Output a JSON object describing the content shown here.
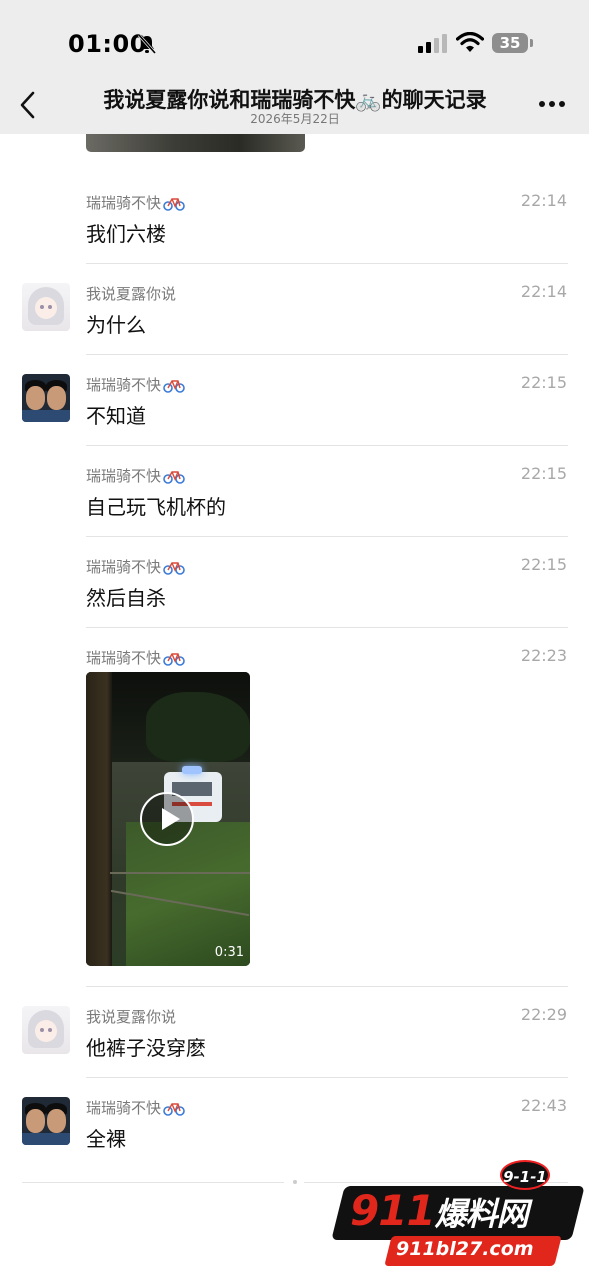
{
  "status_bar": {
    "time": "01:00",
    "battery": "35"
  },
  "header": {
    "title": "我说夏露你说和瑞瑞骑不快🚲的聊天记录",
    "date": "2026年5月22日"
  },
  "messages": [
    {
      "sender": "瑞瑞骑不快",
      "time": "22:14",
      "text": "我们六楼",
      "avatar": "none"
    },
    {
      "sender": "我说夏露你说",
      "time": "22:14",
      "text": "为什么",
      "avatar": "anime-girl"
    },
    {
      "sender": "瑞瑞骑不快",
      "time": "22:15",
      "text": "不知道",
      "avatar": "two-boys"
    },
    {
      "sender": "瑞瑞骑不快",
      "time": "22:15",
      "text": "自己玩飞机杯的",
      "avatar": "none"
    },
    {
      "sender": "瑞瑞骑不快",
      "time": "22:15",
      "text": "然后自杀",
      "avatar": "none"
    },
    {
      "sender": "瑞瑞骑不快",
      "time": "22:23",
      "video_duration": "0:31",
      "avatar": "none"
    },
    {
      "sender": "我说夏露你说",
      "time": "22:29",
      "text": "他裤子没穿麽",
      "avatar": "anime-girl"
    },
    {
      "sender": "瑞瑞骑不快",
      "time": "22:43",
      "text": "全裸",
      "avatar": "two-boys"
    }
  ],
  "watermark": {
    "badge": "9-1-1",
    "brand_num": "911",
    "brand_cn": "爆料网",
    "url": "911bl27.com"
  },
  "colors": {
    "header_bg": "#ededed",
    "text": "#111111",
    "meta": "#a8a8a8",
    "brand_red": "#e1261c"
  }
}
